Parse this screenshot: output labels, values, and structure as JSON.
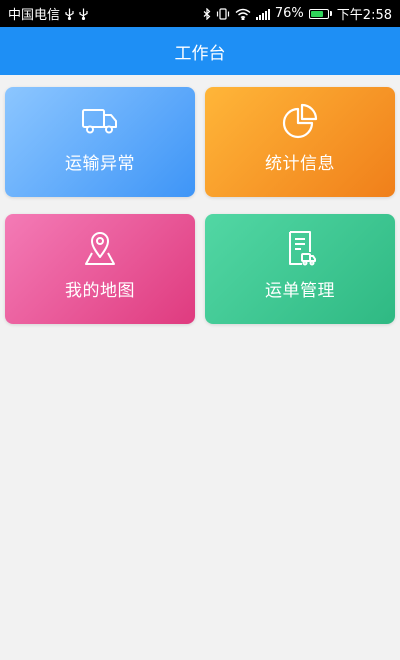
{
  "status_bar": {
    "carrier": "中国电信",
    "battery_percent": "76%",
    "battery_level": 0.76,
    "time": "下午2:58",
    "icons": [
      "usb-icon",
      "bluetooth-icon",
      "vibrate-icon",
      "wifi-icon",
      "signal-icon",
      "battery-icon"
    ]
  },
  "header": {
    "title": "工作台"
  },
  "tiles": [
    {
      "label": "运输异常",
      "icon": "truck-icon",
      "color_start": "#8cc6ff",
      "color_end": "#3e95f7"
    },
    {
      "label": "统计信息",
      "icon": "pie-chart-icon",
      "color_start": "#ffb639",
      "color_end": "#f07f1a"
    },
    {
      "label": "我的地图",
      "icon": "map-pin-icon",
      "color_start": "#f47bb6",
      "color_end": "#df3b7f"
    },
    {
      "label": "运单管理",
      "icon": "waybill-icon",
      "color_start": "#52d7a4",
      "color_end": "#2fb983"
    }
  ],
  "colors": {
    "header_bg": "#1e8ff5",
    "page_bg": "#f2f2f2",
    "status_bg": "#000000"
  }
}
